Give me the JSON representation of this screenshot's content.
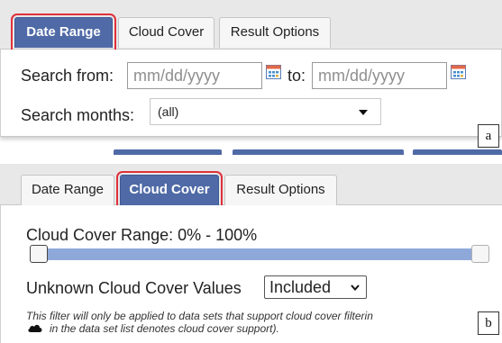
{
  "panel_a": {
    "tabs": [
      {
        "label": "Date Range",
        "active": true
      },
      {
        "label": "Cloud Cover",
        "active": false
      },
      {
        "label": "Result Options",
        "active": false
      }
    ],
    "search_from_label": "Search from:",
    "date_from": {
      "value": "",
      "placeholder": "mm/dd/yyyy"
    },
    "to_label": "to:",
    "date_to": {
      "value": "",
      "placeholder": "mm/dd/yyyy"
    },
    "search_months_label": "Search months:",
    "search_months_value": "(all)",
    "figure_label": "a"
  },
  "panel_b": {
    "tabs": [
      {
        "label": "Date Range",
        "active": false
      },
      {
        "label": "Cloud Cover",
        "active": true
      },
      {
        "label": "Result Options",
        "active": false
      }
    ],
    "cloud_cover_range_label": "Cloud Cover Range: 0% - 100%",
    "slider": {
      "min_percent": 0,
      "max_percent": 100
    },
    "unknown_values_label": "Unknown Cloud Cover Values",
    "unknown_values_selected": "Included",
    "note_line1": "This filter will only be applied to data sets that support cloud cover filterin",
    "note_line2": "in the data set list denotes cloud cover support).",
    "figure_label": "b"
  },
  "colors": {
    "active_tab": "#4f6aa6",
    "highlight_outline": "#e0303a",
    "slider_fill": "#8fa8da"
  },
  "icons": {
    "calendar": "calendar-icon",
    "dropdown": "caret-down-icon",
    "cloud": "cloud-icon"
  }
}
